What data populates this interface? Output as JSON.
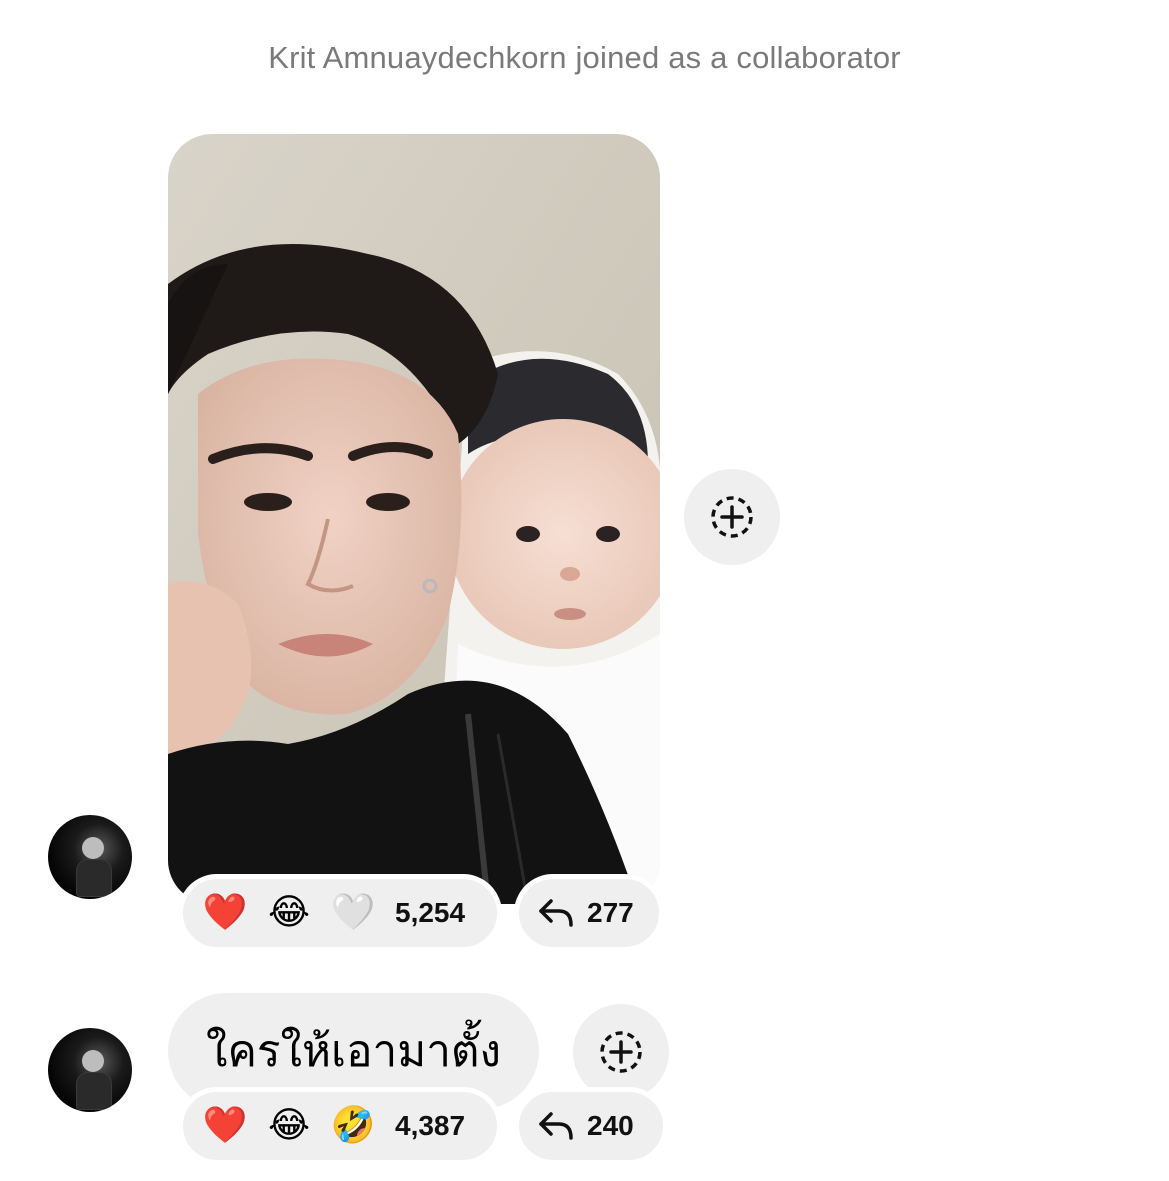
{
  "system_message": "Krit Amnuaydechkorn joined as a collaborator",
  "messages": [
    {
      "type": "photo",
      "reactions": {
        "emojis": [
          "❤️",
          "😂",
          "🤍"
        ],
        "count": "5,254"
      },
      "replies": "277"
    },
    {
      "type": "text",
      "text": "ใครให้เอามาตั้ง",
      "reactions": {
        "emojis": [
          "❤️",
          "😂",
          "🤣"
        ],
        "count": "4,387"
      },
      "replies": "240"
    }
  ],
  "icons": {
    "add_reaction": "add-reaction-icon",
    "reply": "reply-arrow-icon",
    "avatar": "profile-avatar"
  },
  "colors": {
    "bubble": "#efefef",
    "system_text": "#7a7a7a"
  }
}
